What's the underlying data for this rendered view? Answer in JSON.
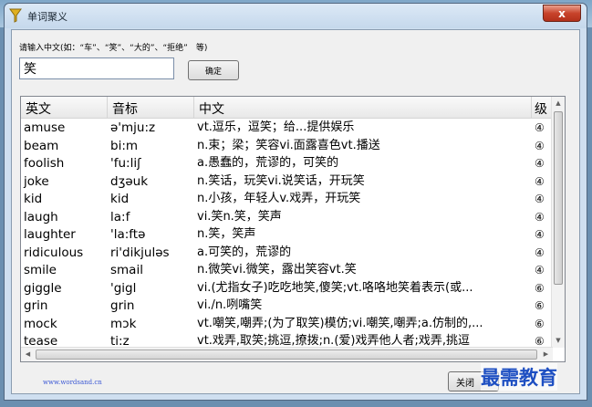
{
  "window": {
    "title": "单词聚义",
    "close_symbol": "x"
  },
  "search": {
    "prompt": "请输入中文(如：“车”、“笑”、“大的”、“拒绝”　等)",
    "value": "笑",
    "confirm_label": "确定"
  },
  "table": {
    "headers": [
      "英文",
      "音标",
      "中文",
      "级"
    ],
    "rows": [
      [
        "amuse",
        "ə'mju:z",
        "vt.逗乐，逗笑；给...提供娱乐",
        "④"
      ],
      [
        "beam",
        "bi:m",
        "n.束；梁；笑容vi.面露喜色vt.播送",
        "④"
      ],
      [
        "foolish",
        "'fu:liʃ",
        "a.愚蠢的，荒谬的，可笑的",
        "④"
      ],
      [
        "joke",
        "dʒəuk",
        "n.笑话，玩笑vi.说笑话，开玩笑",
        "④"
      ],
      [
        "kid",
        "kid",
        "n.小孩，年轻人v.戏弄，开玩笑",
        "④"
      ],
      [
        "laugh",
        "la:f",
        "vi.笑n.笑，笑声",
        "④"
      ],
      [
        "laughter",
        "'la:ftə",
        "n.笑，笑声",
        "④"
      ],
      [
        "ridiculous",
        "ri'dikjuləs",
        "a.可笑的，荒谬的",
        "④"
      ],
      [
        "smile",
        "smail",
        "n.微笑vi.微笑，露出笑容vt.笑",
        "④"
      ],
      [
        "giggle",
        "'gigl",
        "vi.(尤指女子)吃吃地笑,傻笑;vt.咯咯地笑着表示(或...",
        "⑥"
      ],
      [
        "grin",
        "grin",
        "vi./n.咧嘴笑",
        "⑥"
      ],
      [
        "mock",
        "mɔk",
        "vt.嘲笑,嘲弄;(为了取笑)模仿;vi.嘲笑,嘲弄;a.仿制的,...",
        "⑥"
      ],
      [
        "tease",
        "ti:z",
        "vt.戏弄,取笑;挑逗,撩拨;n.(爱)戏弄他人者;戏弄,挑逗",
        "⑥"
      ]
    ]
  },
  "footer": {
    "site": "www.wordsand.cn",
    "close_label": "关闭",
    "watermark": "最需教育"
  },
  "colors": {
    "accent": "#1e4fc2",
    "title_close": "#c8432b"
  }
}
